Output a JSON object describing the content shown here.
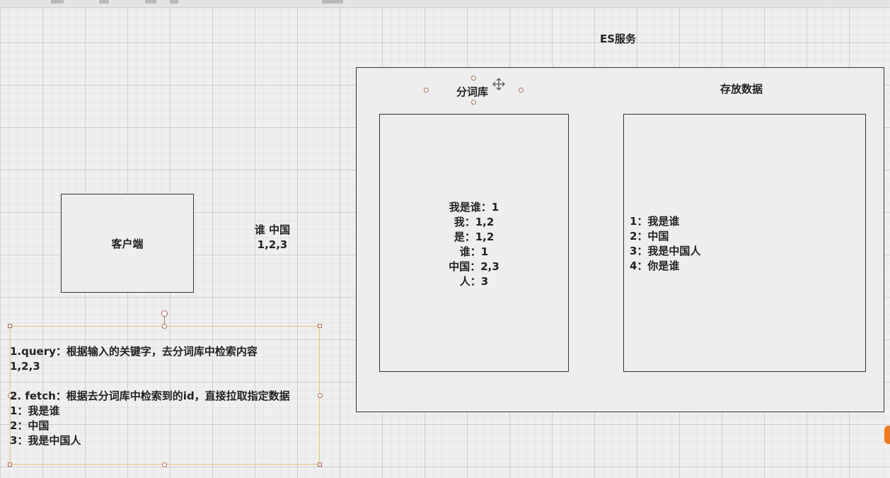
{
  "diagram": {
    "es_service_title": "ES服务",
    "tokenizer_title": "分词库",
    "storage_title": "存放数据",
    "client_label": "客户端",
    "query_terms": {
      "line1": "谁 中国",
      "line2": "1,2,3"
    },
    "tokenizer_entries": [
      "我是谁：1",
      "我：1,2",
      "是：1,2",
      "谁：1",
      "中国：2,3",
      "人：3"
    ],
    "storage_entries": [
      "1：我是谁",
      "2：中国",
      "3：我是中国人",
      "4：你是谁"
    ],
    "notes": [
      "1.query：根据输入的关键字，去分词库中检索内容",
      "1,2,3",
      "",
      "2. fetch：根据去分词库中检索到的id，直接拉取指定数据",
      "1：我是谁",
      "2：中国",
      "3：我是中国人"
    ]
  }
}
